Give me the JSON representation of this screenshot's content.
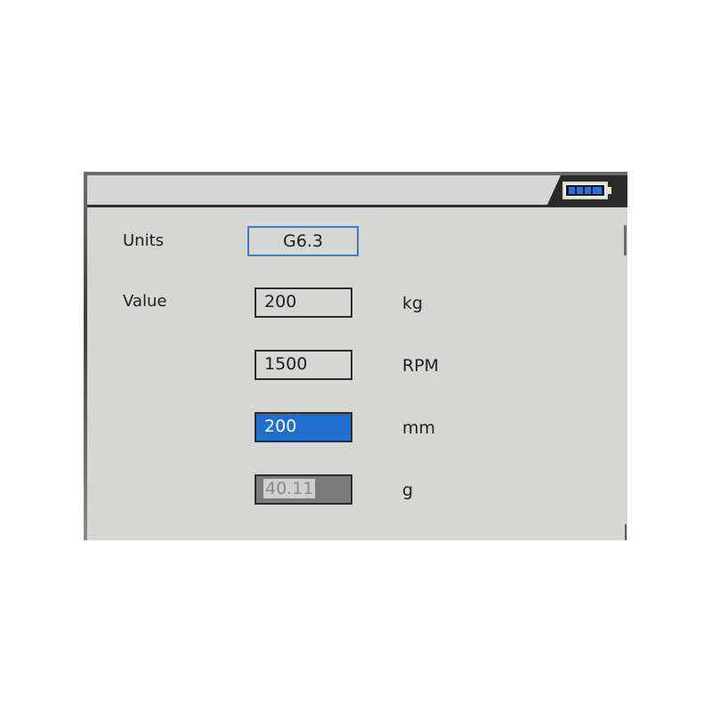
{
  "units": {
    "label": "Units",
    "value": "G6.3"
  },
  "value_section": {
    "label": "Value",
    "rows": [
      {
        "value": "200",
        "unit": "kg"
      },
      {
        "value": "1500",
        "unit": "RPM"
      },
      {
        "value": "200",
        "unit": "mm"
      },
      {
        "value": "40.11",
        "unit": "g"
      }
    ]
  },
  "colors": {
    "panel_bg": "#d6d7d4",
    "selection": "#1f6fcf",
    "focus_border": "#3e7cc4",
    "battery_fill": "#1a56b0"
  }
}
